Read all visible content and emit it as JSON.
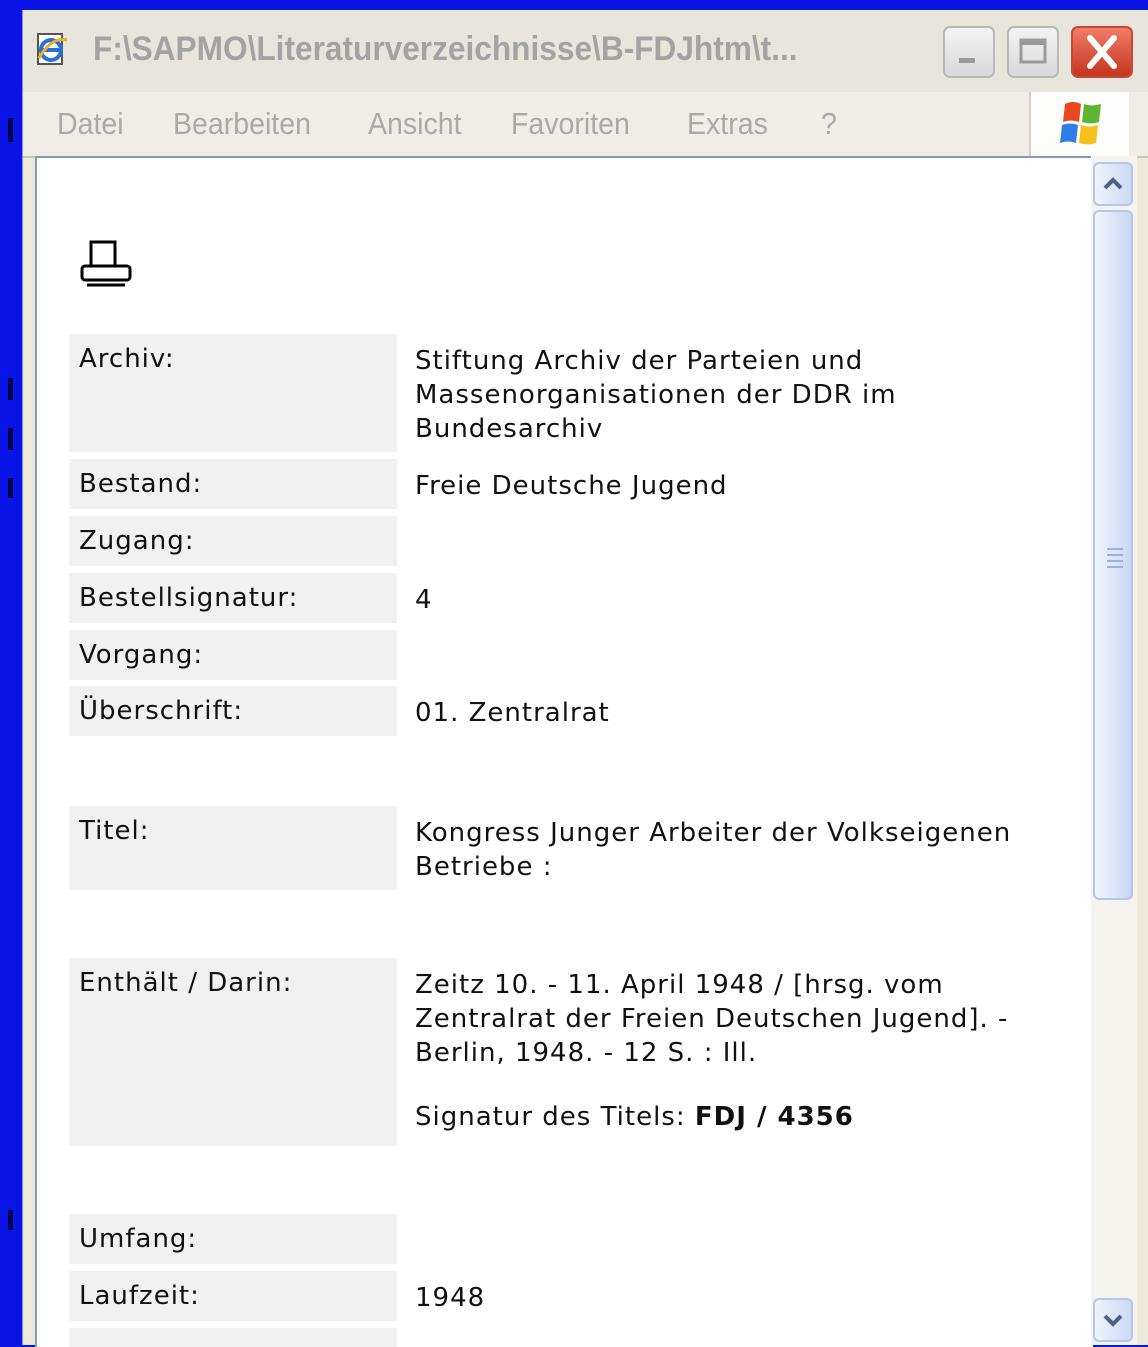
{
  "window": {
    "title": "F:\\SAPMO\\Literaturverzeichnisse\\B-FDJhtm\\t..."
  },
  "menu": {
    "items": [
      "Datei",
      "Bearbeiten",
      "Ansicht",
      "Favoriten",
      "Extras",
      "?"
    ]
  },
  "icons": {
    "app": "ie-page-icon",
    "print": "printer-icon",
    "minimize": "minimize-icon",
    "maximize": "maximize-icon",
    "close": "close-icon",
    "logo": "windows-flag-logo"
  },
  "record": {
    "archiv_label": "Archiv:",
    "archiv_value": "Stiftung Archiv der Parteien und Massenorganisationen der DDR im Bundesarchiv",
    "bestand_label": "Bestand:",
    "bestand_value": "Freie Deutsche Jugend",
    "zugang_label": "Zugang:",
    "zugang_value": "",
    "bestellsignatur_label": "Bestellsignatur:",
    "bestellsignatur_value": "4",
    "vorgang_label": "Vorgang:",
    "vorgang_value": "",
    "ueberschrift_label": "Überschrift:",
    "ueberschrift_value": "01. Zentralrat",
    "titel_label": "Titel:",
    "titel_value": "Kongress Junger Arbeiter der Volkseigenen Betriebe :",
    "enthaelt_label": "Enthält / Darin:",
    "enthaelt_value": "Zeitz 10. - 11. April 1948 / [hrsg. vom Zentralrat der Freien Deutschen Jugend]. - Berlin, 1948. - 12 S. : Ill.",
    "signatur_prefix": "Signatur des Titels:",
    "signatur_value": "FDJ / 4356",
    "umfang_label": "Umfang:",
    "umfang_value": "",
    "laufzeit_label": "Laufzeit:",
    "laufzeit_value": "1948"
  },
  "colors": {
    "desktop": "#0a14e6",
    "title_text_inactive": "#a3a3a3",
    "label_bg": "#f1f1f1",
    "close_button": "#d9452a"
  }
}
